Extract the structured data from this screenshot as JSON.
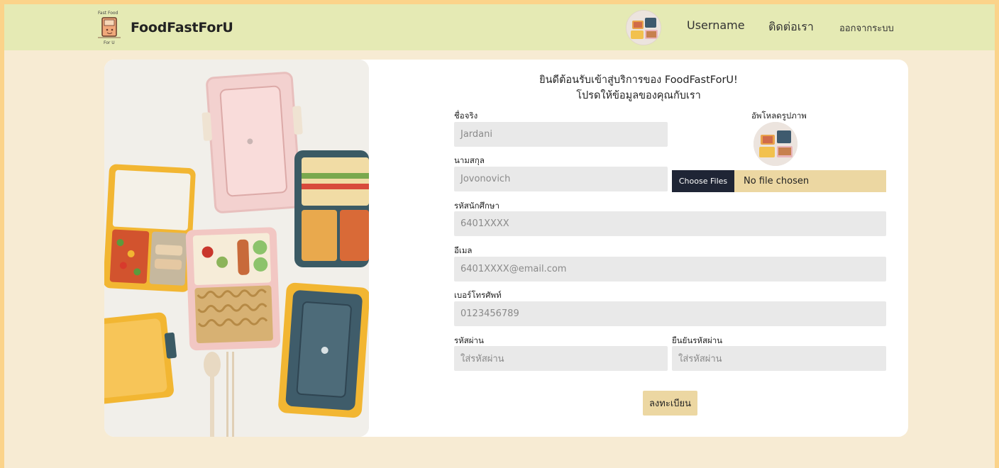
{
  "nav": {
    "brand": "FoodFastForU",
    "logo_text_top": "Fast Food",
    "logo_text_bottom": "For U",
    "username": "Username",
    "contact": "ติดต่อเรา",
    "logout": "ออกจากระบบ"
  },
  "form": {
    "welcome": "ยินดีต้อนรับเข้าสู่บริการของ FoodFastForU!",
    "subtitle": "โปรดให้ข้อมูลของคุณกับเรา",
    "first_name_label": "ชื่อจริง",
    "first_name_value": "Jardani",
    "last_name_label": "นามสกุล",
    "last_name_value": "Jovonovich",
    "upload_label": "อัพโหลดรูปภาพ",
    "file_button": "Choose Files",
    "file_status": "No file chosen",
    "student_id_label": "รหัสนักศึกษา",
    "student_id_value": "6401XXXX",
    "email_label": "อีเมล",
    "email_value": "6401XXXX@email.com",
    "phone_label": "เบอร์โทรศัพท์",
    "phone_value": "0123456789",
    "password_label": "รหัสผ่าน",
    "password_placeholder": "ใส่รหัสผ่าน",
    "confirm_label": "ยืนยันรหัสผ่าน",
    "confirm_placeholder": "ใส่รหัสผ่าน",
    "submit": "ลงทะเบียน"
  },
  "colors": {
    "navbar": "#e5eab4",
    "page_bg": "#f7ebd3",
    "accent": "#ecd7a2",
    "field_bg": "#e9e9e9",
    "dark_button": "#1f2535"
  }
}
